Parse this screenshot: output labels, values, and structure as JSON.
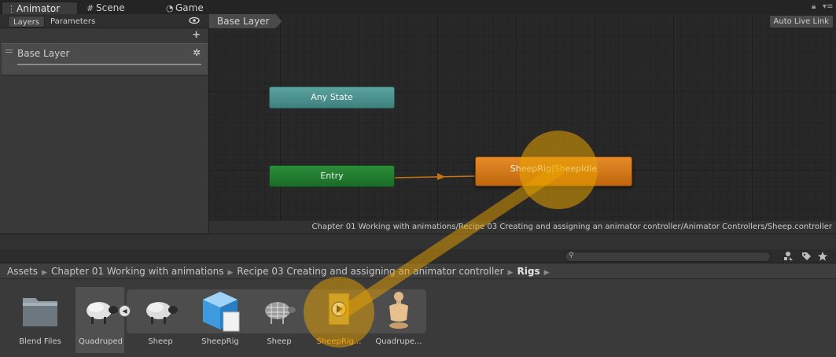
{
  "window_tabs": [
    {
      "label": "Animator",
      "icon": "animator-icon"
    },
    {
      "label": "Scene",
      "icon": "scene-grid-icon"
    },
    {
      "label": "Game",
      "icon": "game-pacman-icon"
    }
  ],
  "layers_panel": {
    "tabs": [
      "Layers",
      "Parameters"
    ],
    "add_label": "+",
    "layers": [
      {
        "name": "Base Layer"
      }
    ]
  },
  "graph": {
    "breadcrumb": "Base Layer",
    "auto_live_link": "Auto Live Link",
    "states": {
      "any": "Any State",
      "entry": "Entry",
      "default": "SheepRig|SheepIdle"
    },
    "colors": {
      "any_state": "#4f9692",
      "entry": "#237e31",
      "default_state": "#d87a1b",
      "highlight": "#e8a200"
    },
    "asset_path": "Chapter 01 Working with animations/Recipe 03 Creating and assigning an animator controller/Animator Controllers/Sheep.controller"
  },
  "project": {
    "search_placeholder": "",
    "path": [
      "Assets",
      "Chapter 01 Working with animations",
      "Recipe 03 Creating and assigning an animator controller",
      "Rigs"
    ],
    "assets": [
      {
        "label": "Blend Files",
        "icon": "folder-icon"
      },
      {
        "label": "Quadruped",
        "icon": "sheep-model-icon"
      },
      {
        "label": "Sheep",
        "icon": "sheep-model-icon"
      },
      {
        "label": "SheepRig",
        "icon": "prefab-cube-icon"
      },
      {
        "label": "Sheep",
        "icon": "sheep-wireframe-icon"
      },
      {
        "label": "SheepRig...",
        "icon": "animation-clip-icon"
      },
      {
        "label": "Quadrupe...",
        "icon": "avatar-icon"
      }
    ]
  }
}
